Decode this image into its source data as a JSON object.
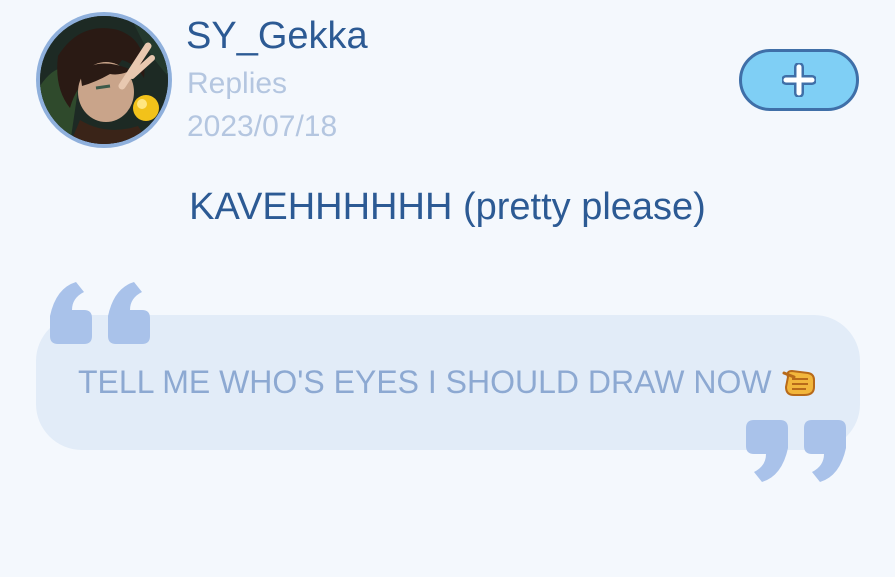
{
  "post": {
    "username": "SY_Gekka",
    "label": "Replies",
    "date": "2023/07/18",
    "title": "KAVEHHHHHH (pretty please)",
    "quote": "TELL ME WHO'S EYES I SHOULD DRAW NOW"
  },
  "icons": {
    "follow": "plus-icon",
    "quote_open": "open-quote-icon",
    "quote_close": "close-quote-icon",
    "emoji": "pointing-fist-emoji"
  },
  "colors": {
    "background": "#f4f8fd",
    "primary_text": "#2c5a94",
    "muted_text": "#b4c6e0",
    "quote_card": "#e2ecf8",
    "quote_marks": "#a9c2ea",
    "button_fill": "#7fcff5",
    "button_border": "#3f6fa8"
  }
}
